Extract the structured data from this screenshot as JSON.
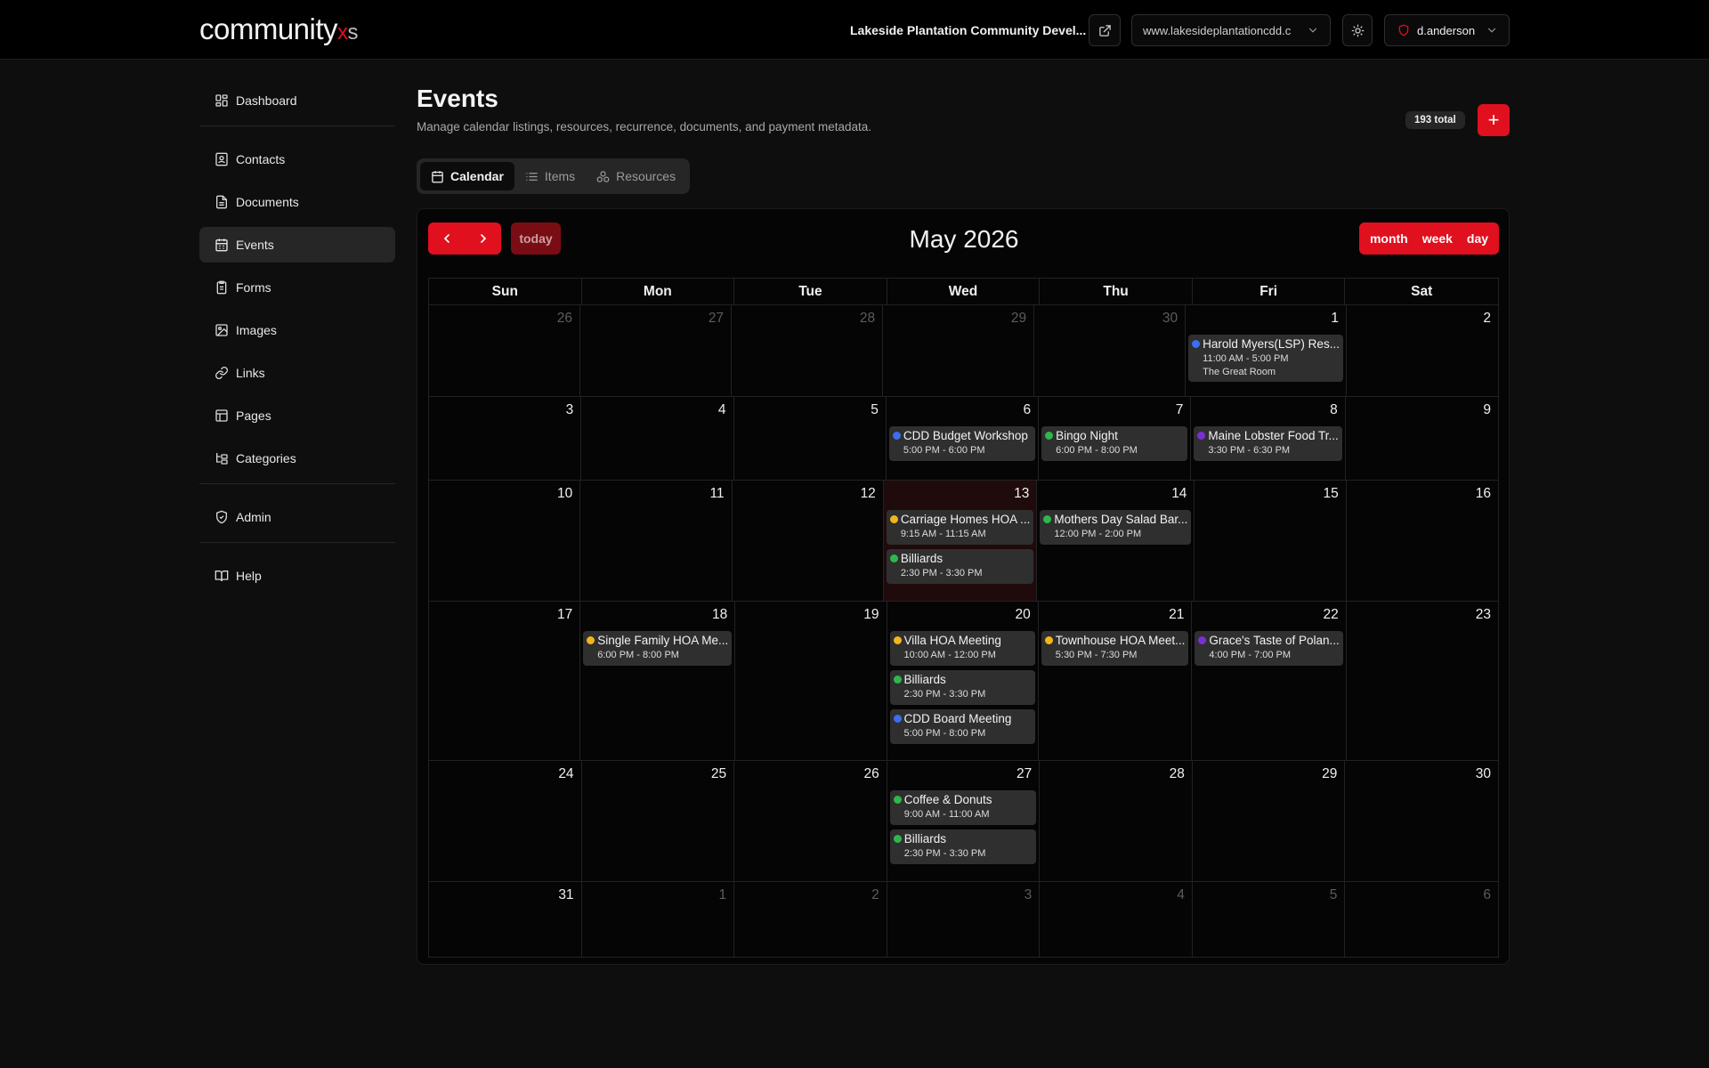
{
  "header": {
    "logo_main": "community",
    "logo_x": "x",
    "logo_s": "s",
    "site_name": "Lakeside Plantation Community Devel...",
    "url_value": "www.lakesideplantationcdd.c",
    "user_name": "d.anderson"
  },
  "sidebar": {
    "items": [
      {
        "label": "Dashboard",
        "icon": "dashboard-icon"
      },
      {
        "label": "Contacts",
        "icon": "contacts-icon"
      },
      {
        "label": "Documents",
        "icon": "documents-icon"
      },
      {
        "label": "Events",
        "icon": "calendar-icon",
        "active": true
      },
      {
        "label": "Forms",
        "icon": "forms-icon"
      },
      {
        "label": "Images",
        "icon": "images-icon"
      },
      {
        "label": "Links",
        "icon": "link-icon"
      },
      {
        "label": "Pages",
        "icon": "pages-icon"
      },
      {
        "label": "Categories",
        "icon": "categories-icon"
      },
      {
        "label": "Admin",
        "icon": "shield-icon"
      },
      {
        "label": "Help",
        "icon": "book-icon"
      }
    ]
  },
  "main": {
    "title": "Events",
    "subtitle": "Manage calendar listings, resources, recurrence, documents, and payment metadata.",
    "total_badge": "193 total",
    "add_label": "+",
    "tabs": [
      {
        "label": "Calendar",
        "active": true
      },
      {
        "label": "Items"
      },
      {
        "label": "Resources"
      }
    ]
  },
  "calendar": {
    "title": "May 2026",
    "today_label": "today",
    "views": [
      "month",
      "week",
      "day"
    ],
    "days_of_week": [
      "Sun",
      "Mon",
      "Tue",
      "Wed",
      "Thu",
      "Fri",
      "Sat"
    ],
    "colors": {
      "blue": "#3b6ef0",
      "green": "#2eb84b",
      "yellow": "#f2b51b",
      "purple": "#7a2fd6",
      "accent": "#e0101e"
    },
    "weeks": [
      {
        "days": [
          {
            "num": "26",
            "other": true
          },
          {
            "num": "27",
            "other": true
          },
          {
            "num": "28",
            "other": true
          },
          {
            "num": "29",
            "other": true
          },
          {
            "num": "30",
            "other": true
          },
          {
            "num": "1",
            "events": [
              {
                "title": "Harold Myers(LSP) Res...",
                "time": "11:00 AM - 5:00 PM",
                "location": "The Great Room",
                "color": "blue"
              }
            ]
          },
          {
            "num": "2"
          }
        ]
      },
      {
        "days": [
          {
            "num": "3"
          },
          {
            "num": "4"
          },
          {
            "num": "5"
          },
          {
            "num": "6",
            "events": [
              {
                "title": "CDD Budget Workshop",
                "time": "5:00 PM - 6:00 PM",
                "color": "blue"
              }
            ]
          },
          {
            "num": "7",
            "events": [
              {
                "title": "Bingo Night",
                "time": "6:00 PM - 8:00 PM",
                "color": "green"
              }
            ]
          },
          {
            "num": "8",
            "events": [
              {
                "title": "Maine Lobster Food Tr...",
                "time": "3:30 PM - 6:30 PM",
                "color": "purple"
              }
            ]
          },
          {
            "num": "9"
          }
        ]
      },
      {
        "days": [
          {
            "num": "10"
          },
          {
            "num": "11"
          },
          {
            "num": "12"
          },
          {
            "num": "13",
            "today": true,
            "events": [
              {
                "title": "Carriage Homes HOA ...",
                "time": "9:15 AM - 11:15 AM",
                "color": "yellow"
              },
              {
                "title": "Billiards",
                "time": "2:30 PM - 3:30 PM",
                "color": "green"
              }
            ]
          },
          {
            "num": "14",
            "events": [
              {
                "title": "Mothers Day Salad Bar...",
                "time": "12:00 PM - 2:00 PM",
                "color": "green"
              }
            ]
          },
          {
            "num": "15"
          },
          {
            "num": "16"
          }
        ]
      },
      {
        "days": [
          {
            "num": "17"
          },
          {
            "num": "18",
            "events": [
              {
                "title": "Single Family HOA Me...",
                "time": "6:00 PM - 8:00 PM",
                "color": "yellow"
              }
            ]
          },
          {
            "num": "19"
          },
          {
            "num": "20",
            "events": [
              {
                "title": "Villa HOA Meeting",
                "time": "10:00 AM - 12:00 PM",
                "color": "yellow"
              },
              {
                "title": "Billiards",
                "time": "2:30 PM - 3:30 PM",
                "color": "green"
              },
              {
                "title": "CDD Board Meeting",
                "time": "5:00 PM - 8:00 PM",
                "color": "blue"
              }
            ]
          },
          {
            "num": "21",
            "events": [
              {
                "title": "Townhouse HOA Meet...",
                "time": "5:30 PM - 7:30 PM",
                "color": "yellow"
              }
            ]
          },
          {
            "num": "22",
            "events": [
              {
                "title": "Grace's Taste of Polan...",
                "time": "4:00 PM - 7:00 PM",
                "color": "purple"
              }
            ]
          },
          {
            "num": "23"
          }
        ]
      },
      {
        "days": [
          {
            "num": "24"
          },
          {
            "num": "25"
          },
          {
            "num": "26"
          },
          {
            "num": "27",
            "events": [
              {
                "title": "Coffee & Donuts",
                "time": "9:00 AM - 11:00 AM",
                "color": "green"
              },
              {
                "title": "Billiards",
                "time": "2:30 PM - 3:30 PM",
                "color": "green"
              }
            ]
          },
          {
            "num": "28"
          },
          {
            "num": "29"
          },
          {
            "num": "30"
          }
        ]
      },
      {
        "days": [
          {
            "num": "31"
          },
          {
            "num": "1",
            "other": true
          },
          {
            "num": "2",
            "other": true
          },
          {
            "num": "3",
            "other": true
          },
          {
            "num": "4",
            "other": true
          },
          {
            "num": "5",
            "other": true
          },
          {
            "num": "6",
            "other": true
          }
        ]
      }
    ]
  }
}
